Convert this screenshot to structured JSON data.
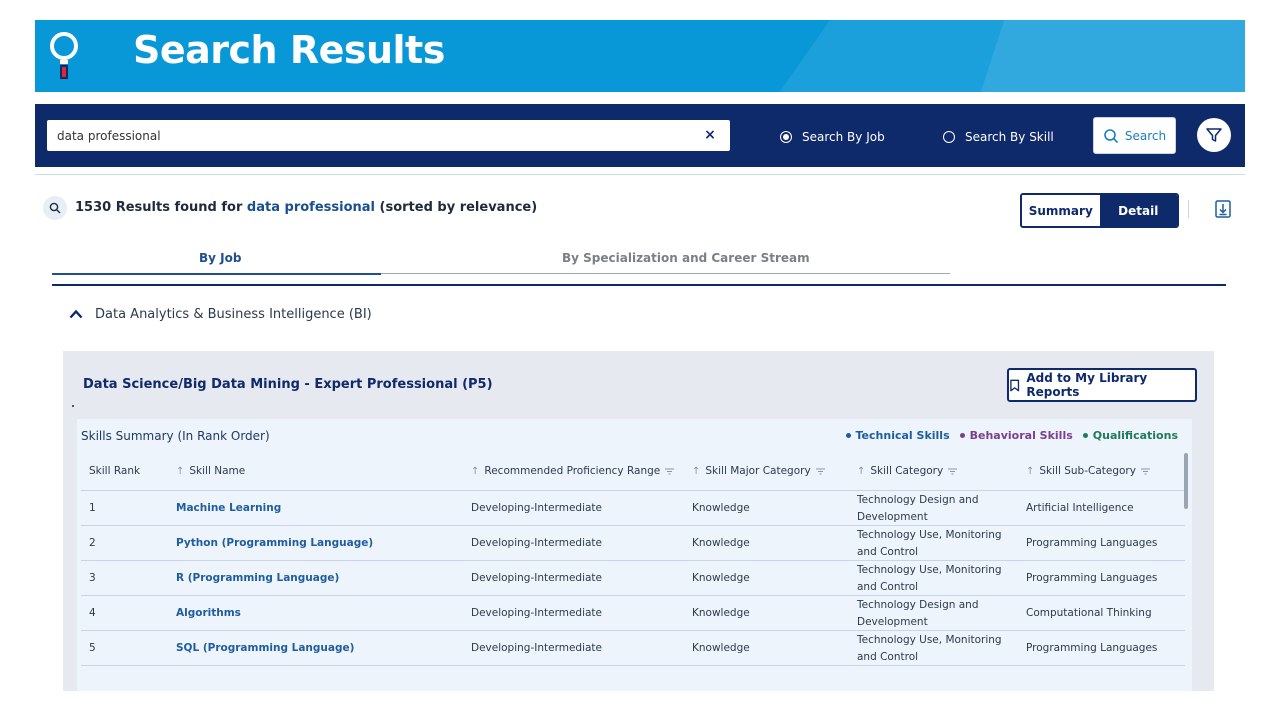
{
  "banner": {
    "title": "Search Results"
  },
  "search": {
    "value": "data professional",
    "clear_glyph": "×",
    "mode_job_label": "Search By Job",
    "mode_skill_label": "Search By Skill",
    "selected_mode": "job",
    "button_label": "Search"
  },
  "results": {
    "count_text": "1530 Results found for",
    "query": "data professional",
    "suffix": "(sorted by relevance)"
  },
  "view_toggle": {
    "summary_label": "Summary",
    "detail_label": "Detail",
    "active": "detail"
  },
  "tabs": [
    {
      "label": "By Job",
      "active": true
    },
    {
      "label": "By Specialization and Career Stream",
      "active": false
    }
  ],
  "section": {
    "title": "Data Analytics & Business Intelligence (BI)"
  },
  "job_card": {
    "title": "Data Science/Big Data Mining - Expert Professional (P5)",
    "library_button_label": "Add to My Library Reports",
    "skills_summary_title": "Skills Summary (In Rank Order)",
    "legend": [
      {
        "label": "Technical Skills",
        "color": "#1f5da0"
      },
      {
        "label": "Behavioral Skills",
        "color": "#7a3f8f"
      },
      {
        "label": "Qualifications",
        "color": "#1f7a5a"
      }
    ],
    "table": {
      "headers": {
        "rank": "Skill Rank",
        "name": "Skill Name",
        "proficiency": "Recommended Proficiency Range",
        "major": "Skill Major Category",
        "category": "Skill Category",
        "sub": "Skill Sub-Category"
      },
      "rows": [
        {
          "rank": "1",
          "name": "Machine Learning",
          "proficiency": "Developing-Intermediate",
          "major": "Knowledge",
          "category": "Technology Design and Development",
          "sub": "Artificial Intelligence"
        },
        {
          "rank": "2",
          "name": "Python (Programming Language)",
          "proficiency": "Developing-Intermediate",
          "major": "Knowledge",
          "category": "Technology Use, Monitoring and Control",
          "sub": "Programming Languages"
        },
        {
          "rank": "3",
          "name": "R (Programming Language)",
          "proficiency": "Developing-Intermediate",
          "major": "Knowledge",
          "category": "Technology Use, Monitoring and Control",
          "sub": "Programming Languages"
        },
        {
          "rank": "4",
          "name": "Algorithms",
          "proficiency": "Developing-Intermediate",
          "major": "Knowledge",
          "category": "Technology Design and Development",
          "sub": "Computational Thinking"
        },
        {
          "rank": "5",
          "name": "SQL (Programming Language)",
          "proficiency": "Developing-Intermediate",
          "major": "Knowledge",
          "category": "Technology Use, Monitoring and Control",
          "sub": "Programming Languages"
        }
      ]
    }
  },
  "colors": {
    "brand_blue": "#0898d8",
    "navy": "#0f2a6b",
    "link": "#1f5da0"
  },
  "icons": [
    "bulb-logo-icon",
    "close-icon",
    "radio-icon",
    "search-icon",
    "filter-icon",
    "download-icon",
    "chevron-up-icon",
    "bookmark-icon",
    "sort-arrow-icon",
    "column-filter-icon"
  ]
}
